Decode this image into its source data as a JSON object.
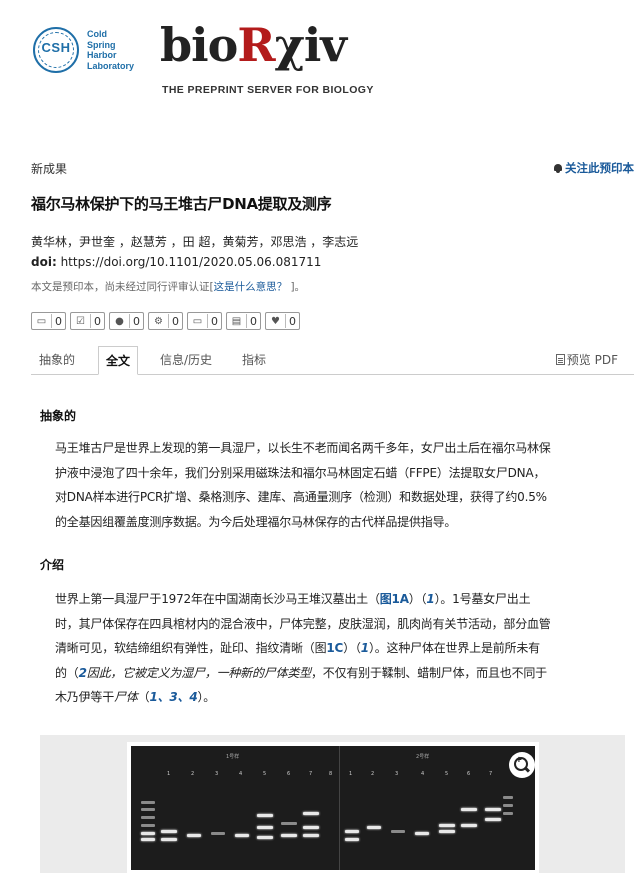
{
  "header": {
    "cshl_abbr": "CSH",
    "cshl_text": "Cold\nSpring\nHarbor\nLaboratory",
    "logo_bio": "bio",
    "logo_r": "R",
    "logo_xiv": "χiv",
    "tagline": "THE PREPRINT SERVER FOR BIOLOGY"
  },
  "meta": {
    "section_label": "新成果",
    "follow_label": "关注此预印本",
    "title": "福尔马林保护下的马王堆古尸DNA提取及测序",
    "authors": "黄华林，尹世奎 ，赵慧芳 ，田 超，黄菊芳，邓思浩 ，李志远",
    "doi_label": "doi:",
    "doi_value": " https://doi.org/10.1101/2020.05.06.081711",
    "notice_text": "本文是预印本，尚未经过同行评审认证[",
    "notice_link": "这是什么意思？ ",
    "notice_end": "]。"
  },
  "metrics": [
    {
      "icon": "comment-icon",
      "glyph": "💬",
      "count": "0"
    },
    {
      "icon": "checkbox-icon",
      "glyph": "☑",
      "count": "0"
    },
    {
      "icon": "users-icon",
      "glyph": "👥",
      "count": "0"
    },
    {
      "icon": "cogs-icon",
      "glyph": "⚙",
      "count": "0"
    },
    {
      "icon": "monitor-icon",
      "glyph": "🖵",
      "count": "0"
    },
    {
      "icon": "film-icon",
      "glyph": "🎞",
      "count": "0"
    },
    {
      "icon": "twitter-icon",
      "glyph": "🐦",
      "count": "0"
    }
  ],
  "tabs": {
    "abstract": "抽象的",
    "fulltext": "全文",
    "info": "信息/历史",
    "metrics": "指标",
    "pdf": "预览 PDF"
  },
  "content": {
    "abstract_heading": "抽象的",
    "abstract_lines": [
      "马王堆古尸是世界上发现的第一具湿尸，以长生不老而闻名两千多年，女尸出土后在福尔马林保",
      "护液中浸泡了四十余年，我们分别采用磁珠法和福尔马林固定石蜡（FFPE）法提取女尸DNA，",
      "对DNA样本进行PCR扩增、桑格测序、建库、高通量测序（检测）和数据处理，获得了约0.5%",
      "的全基因组覆盖度测序数据。为今后处理福尔马林保存的古代样品提供指导。"
    ],
    "intro_heading": "介绍",
    "intro": {
      "l1_a": "世界上第一具湿尸于1972年在中国湖南长沙马王堆汉墓出土（",
      "l1_fig": "图1A",
      "l1_b": "）（",
      "l1_ref": "1",
      "l1_c": "）。1号墓女尸出土",
      "l2": "时，其尸体保存在四具棺材内的混合液中，尸体完整，皮肤湿润，肌肉尚有关节活动，部分血管",
      "l3_a": "清晰可见，软结缔组织有弹性，趾印、指纹清晰（图",
      "l3_fig": "1C",
      "l3_b": "）（",
      "l3_ref": "1",
      "l3_c": "）。这种尸体在世界上是前所未有",
      "l4_a": "的（",
      "l4_ref": "2",
      "l4_em": "因此，它被定义为湿尸，一种新的尸体类型",
      "l4_c": "，不仅有别于鞣制、蜡制尸体，而且也不同于",
      "l5_a": "木乃伊等干",
      "l5_em": "尸体",
      "l5_b": "（",
      "l5_ref": "1、3、4",
      "l5_c": "）。"
    }
  },
  "figure": {
    "left_label": "1号样",
    "right_label": "2号样",
    "left_lanes": [
      "1",
      "2",
      "3",
      "4",
      "5",
      "6",
      "7",
      "8"
    ],
    "right_lanes": [
      "1",
      "2",
      "3",
      "4",
      "5",
      "6",
      "7"
    ]
  }
}
